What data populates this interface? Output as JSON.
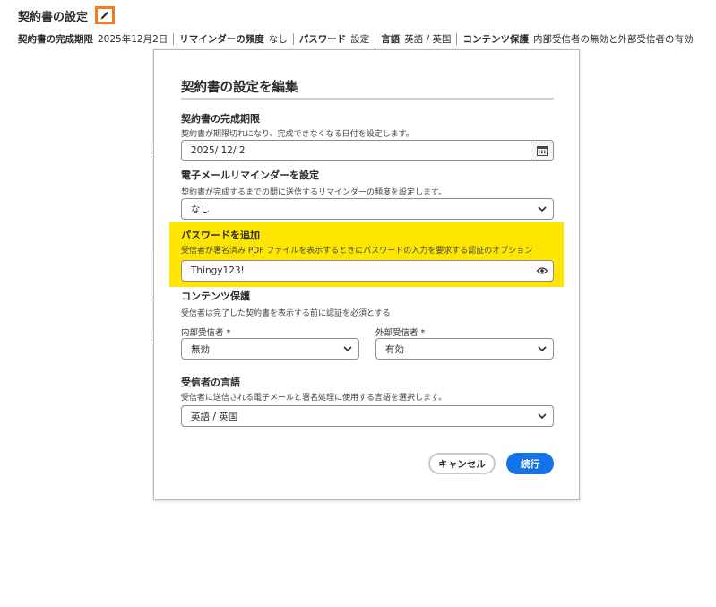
{
  "header": {
    "title": "契約書の設定",
    "summary": [
      {
        "label": "契約書の完成期限",
        "value": "2025年12月2日"
      },
      {
        "label": "リマインダーの頻度",
        "value": "なし"
      },
      {
        "label": "パスワード",
        "value": "設定"
      },
      {
        "label": "言語",
        "value": "英語 / 英国"
      },
      {
        "label": "コンテンツ保護",
        "value": "内部受信者の無効と外部受信者の有効"
      }
    ]
  },
  "modal": {
    "title": "契約書の設定を編集",
    "deadline": {
      "label": "契約書の完成期限",
      "desc": "契約書が期限切れになり、完成できなくなる日付を設定します。",
      "value": "2025/  12/   2"
    },
    "reminder": {
      "label": "電子メールリマインダーを設定",
      "desc": "契約書が完成するまでの間に送信するリマインダーの頻度を設定します。",
      "value": "なし"
    },
    "password": {
      "label": "パスワードを追加",
      "desc": "受信者が署名済み PDF ファイルを表示するときにパスワードの入力を要求する認証のオプション",
      "value": "Thingy123!"
    },
    "protection": {
      "label": "コンテンツ保護",
      "desc": "受信者は完了した契約書を表示する前に認証を必須とする",
      "internal_label": "内部受信者",
      "internal_value": "無効",
      "external_label": "外部受信者",
      "external_value": "有効",
      "required_mark": "*"
    },
    "language": {
      "label": "受信者の言語",
      "desc": "受信者に送信される電子メールと署名処理に使用する言語を選択します。",
      "value": "英語 / 英国"
    },
    "buttons": {
      "cancel": "キャンセル",
      "continue": "続行"
    }
  },
  "colors": {
    "highlight": "#ffe600",
    "edit_outline": "#f47b20",
    "primary": "#1473e6"
  }
}
